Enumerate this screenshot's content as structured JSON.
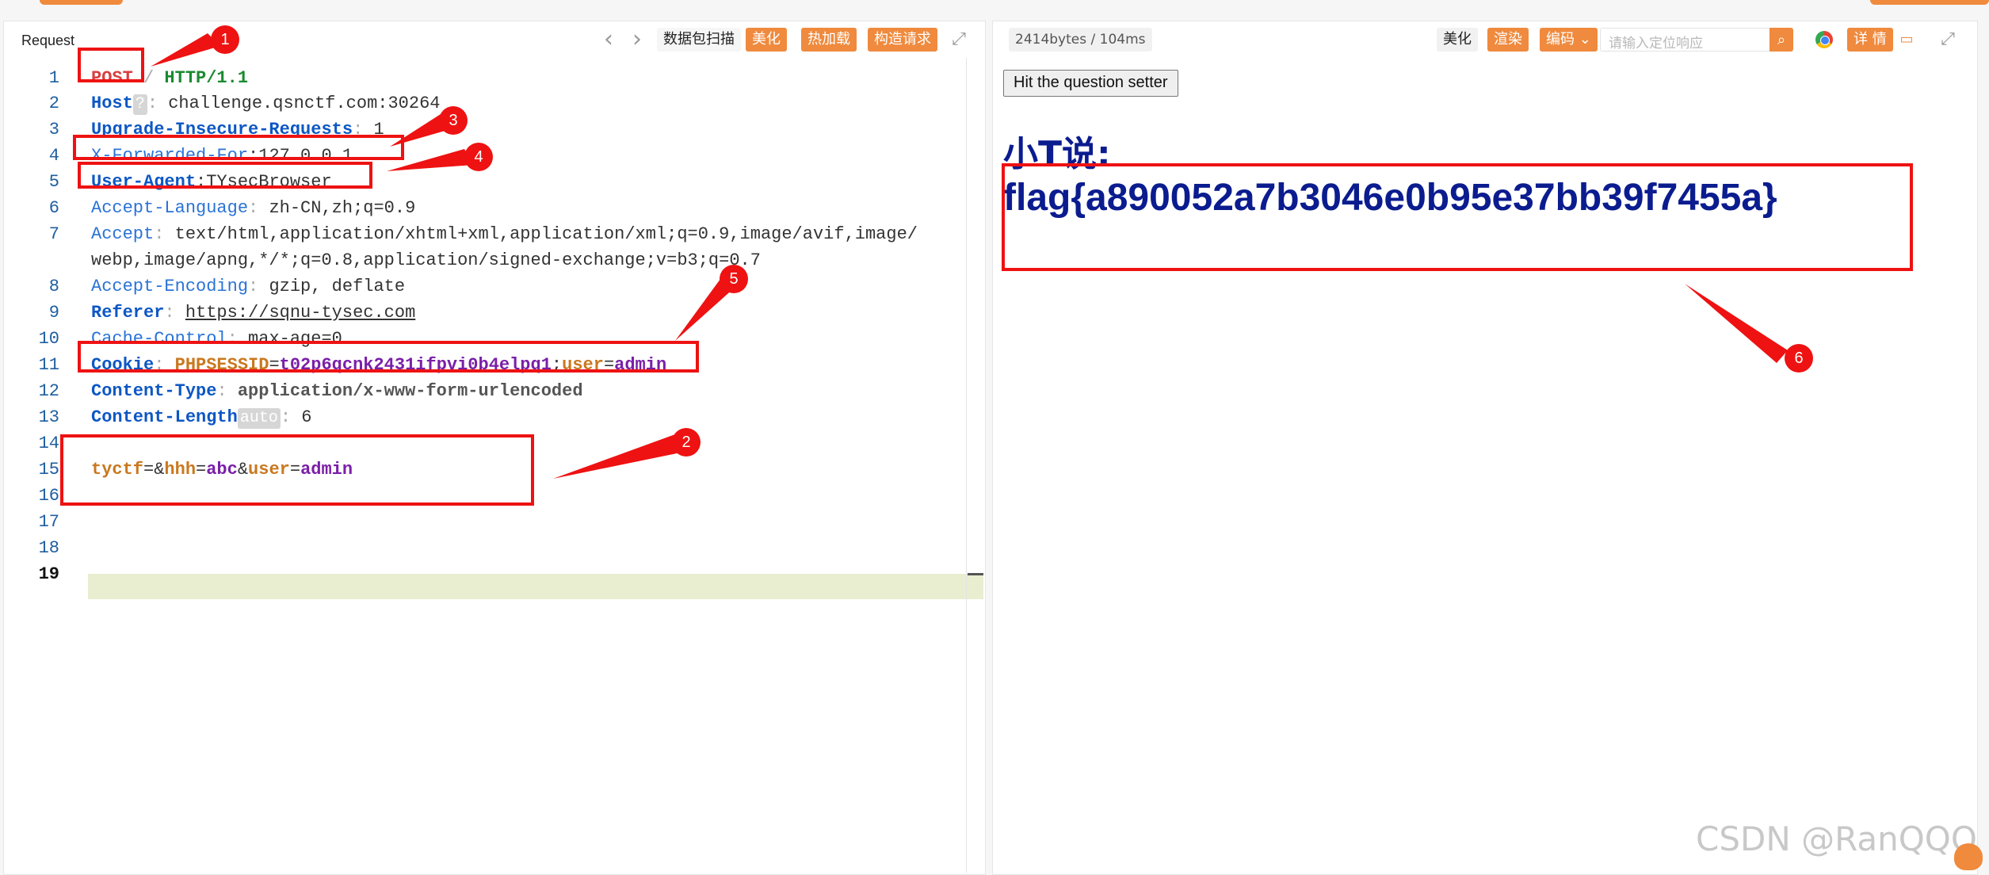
{
  "request_panel": {
    "title": "Request",
    "nav_prev": "‹",
    "nav_next": "›",
    "buttons": {
      "scan": "数据包扫描",
      "beautify": "美化",
      "hot_load": "热加载",
      "build_request": "构造请求"
    },
    "expand_icon": "expand-icon",
    "chip_question": "?",
    "chip_auto": "auto",
    "lines": [
      {
        "n": "1",
        "key": "POST",
        "sep": " / ",
        "val": "HTTP/1.1"
      },
      {
        "n": "2",
        "key": "Host",
        "val": "challenge.qsnctf.com:30264"
      },
      {
        "n": "3",
        "key": "Upgrade-Insecure-Requests",
        "val": "1"
      },
      {
        "n": "4",
        "key": "X-Forwarded-For",
        "val": "127.0.0.1"
      },
      {
        "n": "5",
        "key": "User-Agent",
        "val": "TYsecBrowser"
      },
      {
        "n": "6",
        "key": "Accept-Language",
        "val": "zh-CN,zh;q=0.9"
      },
      {
        "n": "7",
        "key": "Accept",
        "val": "text/html,application/xhtml+xml,application/xml;q=0.9,image/avif,image/",
        "val2": "webp,image/apng,*/*;q=0.8,application/signed-exchange;v=b3;q=0.7"
      },
      {
        "n": "8",
        "key": "Accept-Encoding",
        "val": "gzip, deflate"
      },
      {
        "n": "9",
        "key": "Referer",
        "val": "https://sqnu-tysec.com"
      },
      {
        "n": "10",
        "key": "Cache-Control",
        "val": "max-age=0"
      },
      {
        "n": "11",
        "key": "Cookie",
        "c1k": "PHPSESSID",
        "c1v": "t02p6qcnk2431ifpvi0b4elpq1",
        "c2k": "user",
        "c2v": "admin"
      },
      {
        "n": "12",
        "key": "Content-Type",
        "val": "application/x-www-form-urlencoded"
      },
      {
        "n": "13",
        "key": "Content-Length",
        "val": "6"
      },
      {
        "n": "14"
      },
      {
        "n": "15",
        "b1k": "tyctf",
        "b2k": "hhh",
        "b2v": "abc",
        "b3k": "user",
        "b3v": "admin"
      },
      {
        "n": "16"
      },
      {
        "n": "17"
      },
      {
        "n": "18"
      },
      {
        "n": "19"
      }
    ]
  },
  "response_panel": {
    "stats": "2414bytes / 104ms",
    "buttons": {
      "beautify": "美化",
      "render": "渲染",
      "encoding": "编码",
      "details": "详 情"
    },
    "search_placeholder": "请输入定位响应",
    "button_text": "Hit the question setter",
    "heading": "小T说:",
    "flag": "flag{a890052a7b3046e0b95e37bb39f7455a}"
  },
  "annotations": [
    "1",
    "2",
    "3",
    "4",
    "5",
    "6"
  ],
  "watermark": "CSDN @RanQQQ",
  "colors": {
    "accent": "#ef8a3e",
    "annotation_red": "#ee1212",
    "flag_text": "#0b1c8f"
  }
}
